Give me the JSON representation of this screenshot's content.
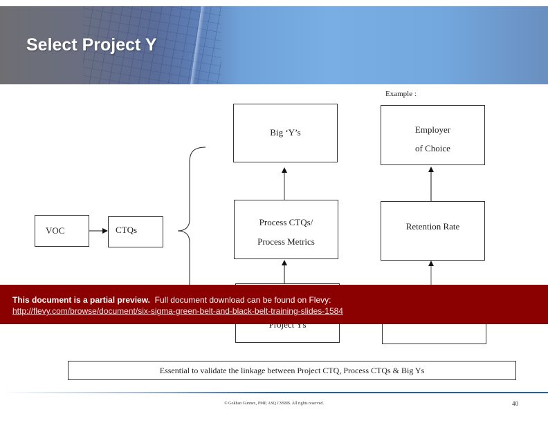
{
  "slide": {
    "title": "Select Project Y",
    "example_label": "Example :",
    "boxes": {
      "voc": "VOC",
      "ctqs": "CTQs",
      "big_ys": "Big ‘Y’s",
      "process_ctqs_line1": "Process CTQs/",
      "process_ctqs_line2": "Process Metrics",
      "project_ys": "Project Ys",
      "employer_line1": "Employer",
      "employer_line2": "of Choice",
      "retention_rate": "Retention Rate",
      "example_bottom": ""
    },
    "note": "Essential to validate the linkage between Project CTQ, Process CTQs & Big Ys",
    "copyright": "© Gokhan Gunner., PMP, ASQ CSSBB. All rights reserved.",
    "page_number": "40"
  },
  "preview_banner": {
    "bold_text": "This document is a partial preview.",
    "text": "Full document download can be found on Flevy:",
    "link": "http://flevy.com/browse/document/six-sigma-green-belt-and-black-belt-training-slides-1584",
    "background_color": "#8b0000"
  }
}
